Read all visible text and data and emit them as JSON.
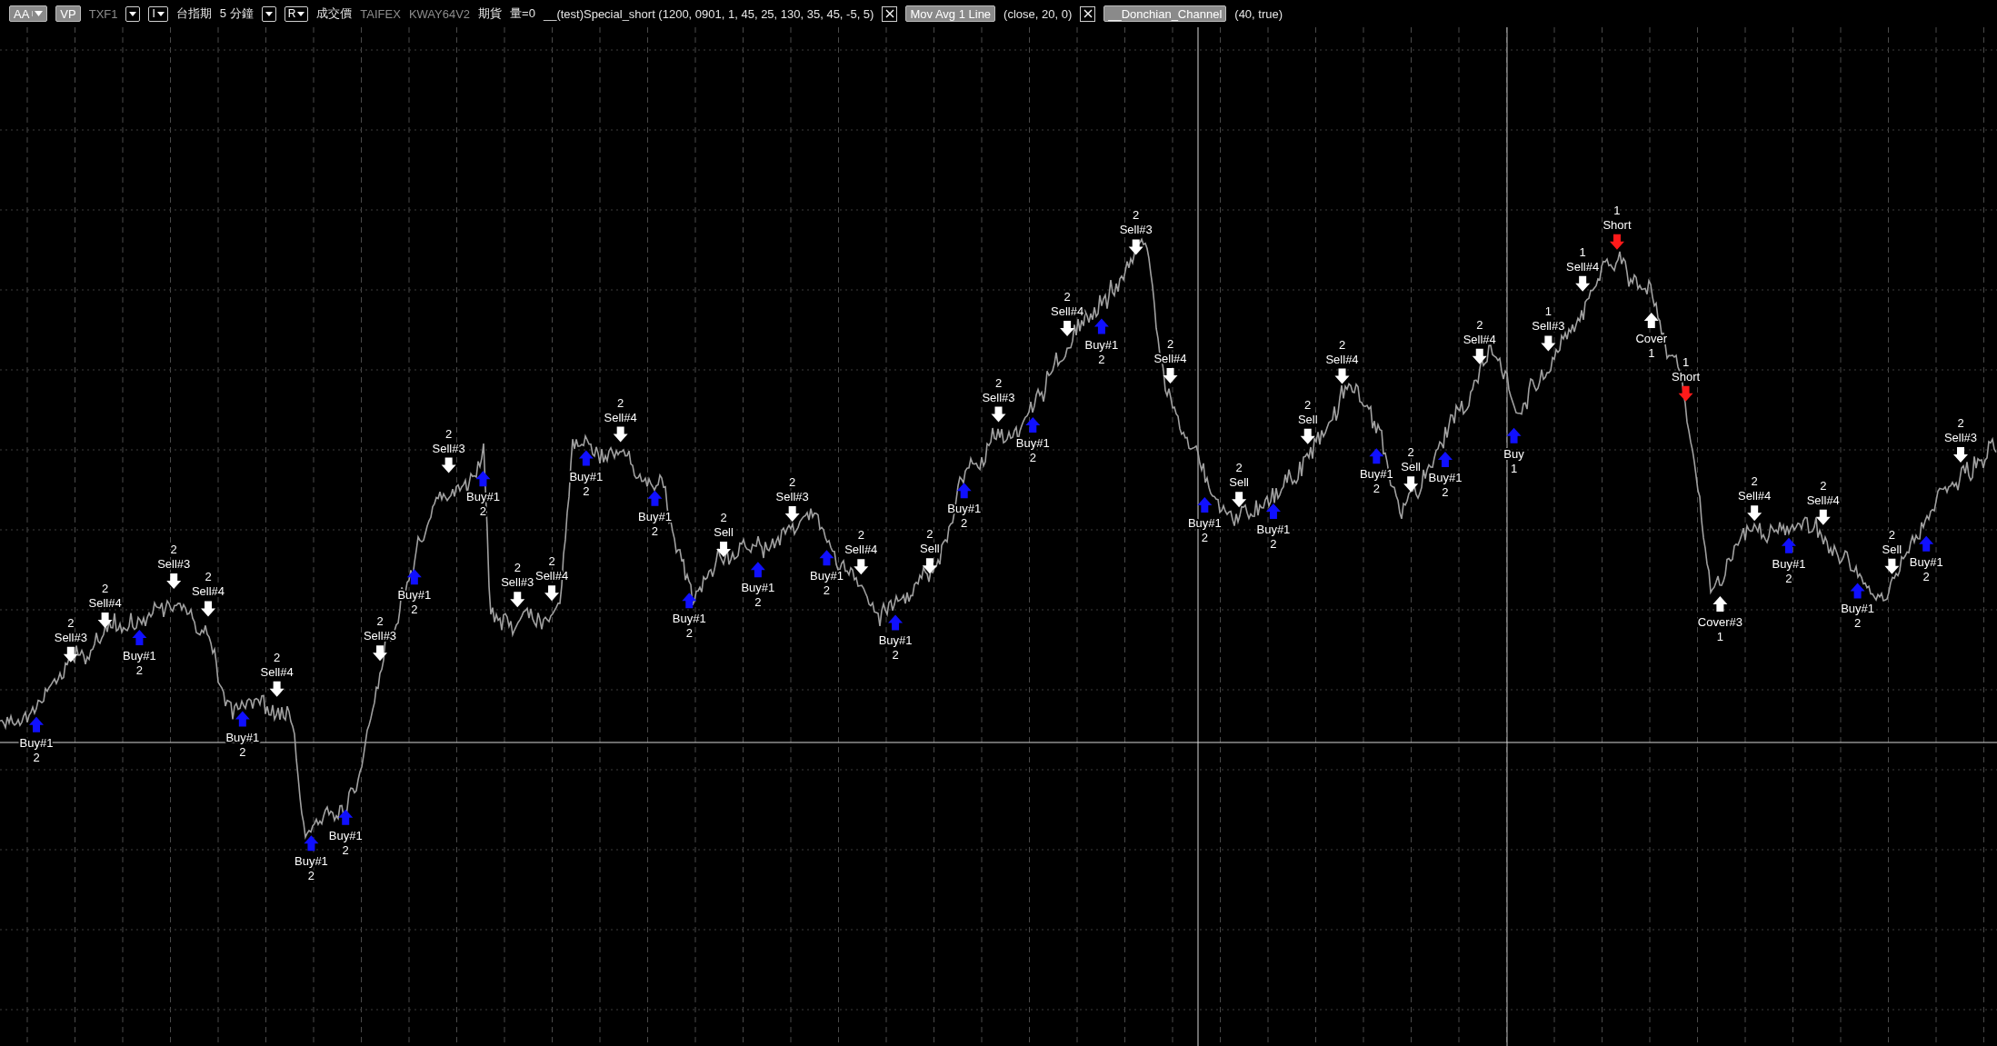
{
  "toolbar": {
    "items": [
      {
        "kind": "button",
        "text": "AA",
        "dropdown": true
      },
      {
        "kind": "button",
        "text": "VP",
        "dropdown": false
      },
      {
        "kind": "text",
        "text": "TXF1",
        "dim": true
      },
      {
        "kind": "dropdown"
      },
      {
        "kind": "dropdown",
        "text": "I"
      },
      {
        "kind": "text",
        "text": "台指期",
        "dim": false
      },
      {
        "kind": "text",
        "text": "5 分鐘",
        "dim": false
      },
      {
        "kind": "dropdown"
      },
      {
        "kind": "dropdown",
        "text": "R"
      },
      {
        "kind": "text",
        "text": "成交價",
        "dim": false
      },
      {
        "kind": "text",
        "text": "TAIFEX",
        "dim": true
      },
      {
        "kind": "text",
        "text": "KWAY64V2",
        "dim": true
      },
      {
        "kind": "text",
        "text": "期貨",
        "dim": false
      },
      {
        "kind": "text",
        "text": "量=0",
        "dim": false
      },
      {
        "kind": "text",
        "text": "__(test)Special_short (1200, 0901, 1, 45, 25, 130, 35, 45, -5, 5)",
        "dim": false
      },
      {
        "kind": "close"
      },
      {
        "kind": "button",
        "text": "Mov Avg 1 Line",
        "dropdown": false
      },
      {
        "kind": "text",
        "text": "(close, 20, 0)",
        "dim": false
      },
      {
        "kind": "close"
      },
      {
        "kind": "button",
        "text": "__Donchian_Channel",
        "dropdown": false
      },
      {
        "kind": "text",
        "text": "(40, true)",
        "dim": false
      }
    ]
  },
  "chart": {
    "signals": [
      {
        "kind": "buy",
        "label": "Buy#1",
        "qty": "2"
      },
      {
        "kind": "sell",
        "label": "Sell#3",
        "qty": "2"
      },
      {
        "kind": "sell",
        "label": "Sell#4",
        "qty": "2"
      },
      {
        "kind": "buy",
        "label": "Buy#1",
        "qty": "2"
      },
      {
        "kind": "sell",
        "label": "Sell#3",
        "qty": "2"
      },
      {
        "kind": "sell",
        "label": "Sell#4",
        "qty": "2"
      },
      {
        "kind": "buy",
        "label": "Buy#1",
        "qty": "2"
      },
      {
        "kind": "sell",
        "label": "Sell#4",
        "qty": "2"
      },
      {
        "kind": "buy",
        "label": "Buy#1",
        "qty": "2"
      },
      {
        "kind": "buy",
        "label": "Buy#1",
        "qty": "2"
      },
      {
        "kind": "sell",
        "label": "Sell#3",
        "qty": "2"
      },
      {
        "kind": "buy",
        "label": "Buy#1",
        "qty": "2"
      },
      {
        "kind": "sell",
        "label": "Sell#3",
        "qty": "2"
      },
      {
        "kind": "buy",
        "label": "Buy#1",
        "qty": "2"
      },
      {
        "kind": "sell",
        "label": "Sell#3",
        "qty": "2"
      },
      {
        "kind": "sell",
        "label": "Sell#4",
        "qty": "2"
      },
      {
        "kind": "buy",
        "label": "Buy#1",
        "qty": "2"
      },
      {
        "kind": "sell",
        "label": "Sell#4",
        "qty": "2"
      },
      {
        "kind": "buy",
        "label": "Buy#1",
        "qty": "2"
      },
      {
        "kind": "buy",
        "label": "Buy#1",
        "qty": "2"
      },
      {
        "kind": "sell",
        "label": "Sell",
        "qty": "2"
      },
      {
        "kind": "buy",
        "label": "Buy#1",
        "qty": "2"
      },
      {
        "kind": "sell",
        "label": "Sell#3",
        "qty": "2"
      },
      {
        "kind": "buy",
        "label": "Buy#1",
        "qty": "2"
      },
      {
        "kind": "sell",
        "label": "Sell#4",
        "qty": "2"
      },
      {
        "kind": "buy",
        "label": "Buy#1",
        "qty": "2"
      },
      {
        "kind": "sell",
        "label": "Sell",
        "qty": "2"
      },
      {
        "kind": "buy",
        "label": "Buy#1",
        "qty": "2"
      },
      {
        "kind": "sell",
        "label": "Sell#3",
        "qty": "2"
      },
      {
        "kind": "buy",
        "label": "Buy#1",
        "qty": "2"
      },
      {
        "kind": "sell",
        "label": "Sell#4",
        "qty": "2"
      },
      {
        "kind": "buy",
        "label": "Buy#1",
        "qty": "2"
      },
      {
        "kind": "sell",
        "label": "Sell#3",
        "qty": "2"
      },
      {
        "kind": "sell",
        "label": "Sell#4",
        "qty": "2"
      },
      {
        "kind": "buy",
        "label": "Buy#1",
        "qty": "2"
      },
      {
        "kind": "sell",
        "label": "Sell",
        "qty": "2"
      },
      {
        "kind": "buy",
        "label": "Buy#1",
        "qty": "2"
      },
      {
        "kind": "sell",
        "label": "Sell",
        "qty": "2"
      },
      {
        "kind": "sell",
        "label": "Sell#4",
        "qty": "2"
      },
      {
        "kind": "buy",
        "label": "Buy#1",
        "qty": "2"
      },
      {
        "kind": "sell",
        "label": "Sell",
        "qty": "2"
      },
      {
        "kind": "buy",
        "label": "Buy#1",
        "qty": "2"
      },
      {
        "kind": "sell",
        "label": "Sell#4",
        "qty": "2"
      },
      {
        "kind": "buy",
        "label": "Buy",
        "qty": "1"
      },
      {
        "kind": "sell",
        "label": "Sell#3",
        "qty": "1"
      },
      {
        "kind": "sell",
        "label": "Sell#4",
        "qty": "1"
      },
      {
        "kind": "short",
        "label": "Short",
        "qty": "1"
      },
      {
        "kind": "cover",
        "label": "Cover",
        "qty": "1"
      },
      {
        "kind": "short",
        "label": "Short",
        "qty": "1"
      },
      {
        "kind": "cover",
        "label": "Cover#3",
        "qty": "1"
      },
      {
        "kind": "sell",
        "label": "Sell#4",
        "qty": "2"
      },
      {
        "kind": "buy",
        "label": "Buy#1",
        "qty": "2"
      },
      {
        "kind": "sell",
        "label": "Sell#4",
        "qty": "2"
      },
      {
        "kind": "buy",
        "label": "Buy#1",
        "qty": "2"
      },
      {
        "kind": "sell",
        "label": "Sell",
        "qty": "2"
      },
      {
        "kind": "buy",
        "label": "Buy#1",
        "qty": "2"
      },
      {
        "kind": "sell",
        "label": "Sell#3",
        "qty": "2"
      }
    ]
  }
}
